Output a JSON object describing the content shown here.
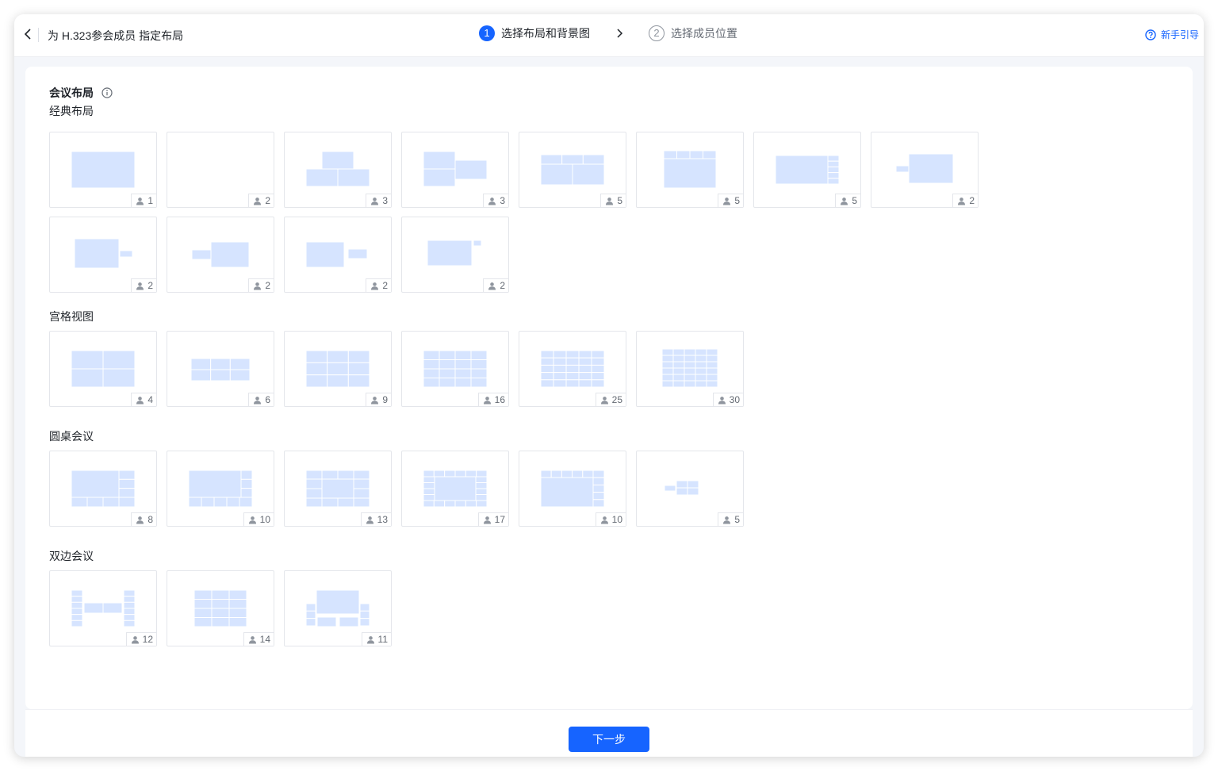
{
  "header": {
    "title": "为 H.323参会成员 指定布局",
    "steps": [
      {
        "number": "1",
        "label": "选择布局和背景图"
      },
      {
        "number": "2",
        "label": "选择成员位置"
      }
    ],
    "help_label": "新手引导"
  },
  "section_title": "会议布局",
  "groups": [
    {
      "label": "经典布局",
      "counts": [
        "1",
        "2",
        "3",
        "3",
        "5",
        "5",
        "5",
        "2",
        "2",
        "2",
        "2",
        "2"
      ]
    },
    {
      "label": "宫格视图",
      "counts": [
        "4",
        "6",
        "9",
        "16",
        "25",
        "30"
      ]
    },
    {
      "label": "圆桌会议",
      "counts": [
        "8",
        "10",
        "13",
        "17",
        "10",
        "5"
      ]
    },
    {
      "label": "双边会议",
      "counts": [
        "12",
        "14",
        "11"
      ]
    }
  ],
  "footer": {
    "next_label": "下一步"
  },
  "colors": {
    "accent": "#1664ff",
    "tile_fill": "#d6e4ff"
  }
}
